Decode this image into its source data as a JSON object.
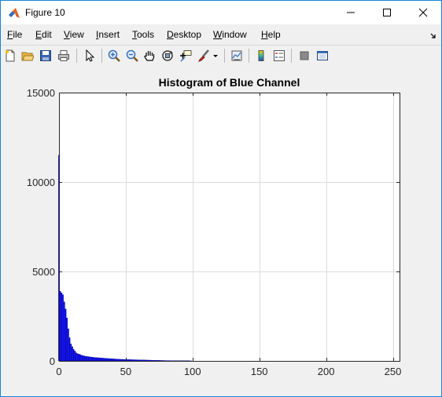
{
  "window": {
    "title": "Figure 10"
  },
  "menu": {
    "items": [
      {
        "pre": "",
        "u": "F",
        "post": "ile"
      },
      {
        "pre": "",
        "u": "E",
        "post": "dit"
      },
      {
        "pre": "",
        "u": "V",
        "post": "iew"
      },
      {
        "pre": "",
        "u": "I",
        "post": "nsert"
      },
      {
        "pre": "",
        "u": "T",
        "post": "ools"
      },
      {
        "pre": "",
        "u": "D",
        "post": "esktop"
      },
      {
        "pre": "",
        "u": "W",
        "post": "indow"
      },
      {
        "pre": "",
        "u": "H",
        "post": "elp"
      }
    ]
  },
  "toolbar": {
    "icons": [
      "new-figure-icon",
      "open-file-icon",
      "save-icon",
      "print-icon",
      "select-arrow-icon",
      "zoom-in-icon",
      "zoom-out-icon",
      "pan-hand-icon",
      "rotate-3d-icon",
      "data-cursor-icon",
      "brush-icon",
      "brush-dropdown-icon",
      "link-plot-icon",
      "colorbar-icon",
      "legend-icon",
      "hide-plot-tools-icon",
      "show-plot-tools-icon"
    ]
  },
  "colors": {
    "bar": "#0000ff",
    "grid": "#dcdcdc",
    "title_bar_border": "#1883d7"
  },
  "chart_data": {
    "type": "bar",
    "title": "Histogram of Blue Channel",
    "xlabel": "",
    "ylabel": "",
    "xlim": [
      0,
      255
    ],
    "ylim": [
      0,
      15000
    ],
    "xticks": [
      "0",
      "50",
      "100",
      "150",
      "200",
      "250"
    ],
    "yticks": [
      "0",
      "5000",
      "10000",
      "15000"
    ],
    "grid": true,
    "bins_start": 0,
    "values": [
      11500,
      3900,
      3800,
      3700,
      3300,
      2900,
      2400,
      1800,
      1300,
      950,
      800,
      650,
      550,
      450,
      400,
      380,
      350,
      320,
      300,
      280,
      260,
      250,
      240,
      230,
      220,
      210,
      200,
      190,
      185,
      180,
      175,
      170,
      165,
      160,
      150,
      145,
      140,
      135,
      130,
      125,
      120,
      115,
      110,
      105,
      100,
      95,
      92,
      90,
      88,
      85,
      82,
      80,
      78,
      75,
      72,
      70,
      68,
      66,
      64,
      62,
      60,
      58,
      56,
      54,
      52,
      50,
      48,
      46,
      44,
      42,
      40,
      38,
      36,
      34,
      32,
      30,
      28,
      26,
      24,
      22,
      20,
      19,
      18,
      17,
      16,
      15,
      14,
      13,
      12,
      11,
      10,
      10,
      9,
      9,
      8,
      8,
      7,
      7,
      6,
      6
    ]
  }
}
